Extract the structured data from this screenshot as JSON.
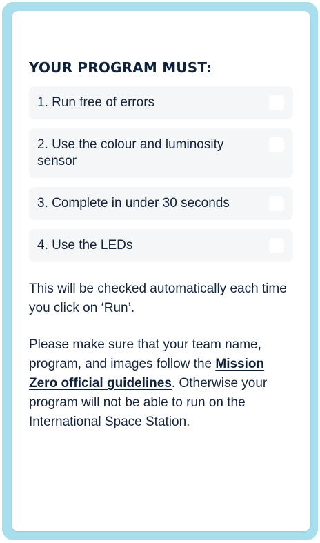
{
  "panel": {
    "heading": "YOUR PROGRAM MUST:",
    "requirements": [
      {
        "label": "1. Run free of errors"
      },
      {
        "label": "2. Use the colour and luminosity sensor"
      },
      {
        "label": "3. Complete in under 30 seconds"
      },
      {
        "label": "4. Use the LEDs"
      }
    ],
    "auto_check_note": "This will be checked automatically each time you click on ‘Run’.",
    "guidelines_before": "Please make sure that your team name, program, and images follow the ",
    "guidelines_link": "Mission Zero official guidelines",
    "guidelines_after": ". Otherwise your program will not be able to run on the International Space Station."
  },
  "colors": {
    "frame": "#a9dfec",
    "item_bg": "#f5f6f8",
    "text": "#14243a"
  }
}
